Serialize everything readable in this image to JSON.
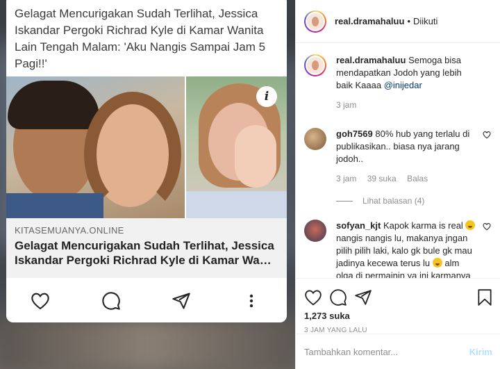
{
  "post_card": {
    "headline": "Gelagat Mencurigakan Sudah Terlihat, Jessica Iskandar Pergoki Richrad Kyle di Kamar Wanita Lain Tengah Malam: 'Aku Nangis Sampai Jam 5 Pagi!!'",
    "info_icon_label": "i",
    "link_domain": "KITASEMUANYA.ONLINE",
    "link_title_line1": "Gelagat Mencurigakan Sudah Terlihat, Jessica",
    "link_title_line2": "Iskandar Pergoki Richrad Kyle di Kamar Wanita Lain Tengah Malam: 'Aku Nangis Sampai Jam 5 Pagi!!'",
    "actions": [
      "heart-icon",
      "comment-icon",
      "share-icon",
      "more-icon"
    ]
  },
  "header": {
    "username": "real.dramahaluu",
    "dot": "•",
    "follow_status": "Diikuti"
  },
  "comments": [
    {
      "username": "real.dramahaluu",
      "text": "Semoga bisa mendapatkan Jodoh yang lebih baik Kaaaa",
      "mention": "@inijedar",
      "time": "3 jam"
    },
    {
      "username": "goh7569",
      "text": "80% hub yang terlalu di publikasikan.. biasa nya jarang jodoh..",
      "time": "3 jam",
      "likes": "39 suka",
      "reply": "Balas",
      "view_replies": "Lihat balasan (4)"
    },
    {
      "username": "sofyan_kjt",
      "text_part1": "Kapok karma is real",
      "text_part2": "nangis nangis lu, makanya jngan pilih pilih laki, kalo gk bule gk mau jadinya kecewa terus lu",
      "text_part3": "alm olga di permainin ya ini karmanya"
    }
  ],
  "post_actions": {
    "likes": "1,273 suka",
    "time_ago": "3 JAM YANG LALU"
  },
  "comment_box": {
    "placeholder": "Tambahkan komentar...",
    "post_label": "Kirim"
  },
  "colors": {
    "link_blue": "#00376b",
    "post_button_disabled": "#b2dffc",
    "muted": "#8e8e8e"
  }
}
